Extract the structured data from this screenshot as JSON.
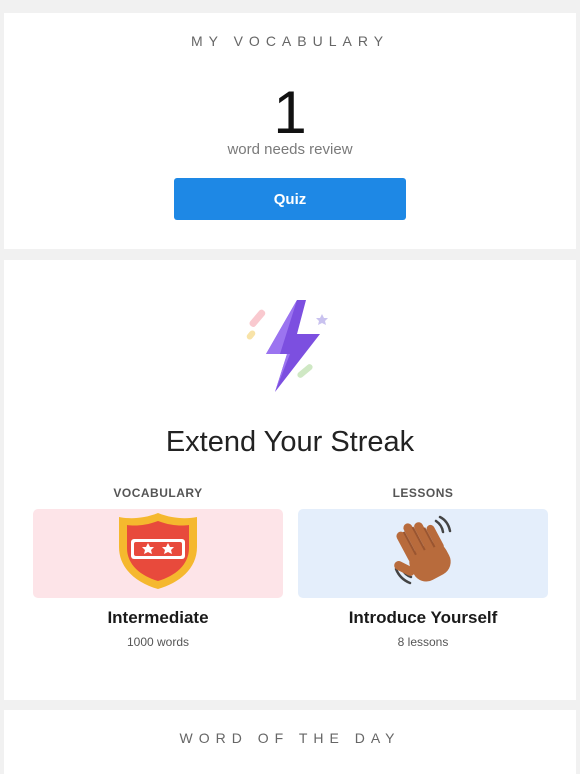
{
  "vocabulary": {
    "header": "MY VOCABULARY",
    "count": "1",
    "caption": "word needs review",
    "quiz_label": "Quiz"
  },
  "streak": {
    "title": "Extend Your Streak",
    "columns": [
      {
        "label": "VOCABULARY",
        "icon": "shield-stars-icon",
        "title": "Intermediate",
        "subtitle": "1000 words",
        "tile_color": "#fde4e8"
      },
      {
        "label": "LESSONS",
        "icon": "waving-hand-icon",
        "title": "Introduce Yourself",
        "subtitle": "8 lessons",
        "tile_color": "#e4eefb"
      }
    ]
  },
  "word_of_the_day": {
    "header": "WORD OF THE DAY"
  },
  "colors": {
    "accent": "#1e88e5",
    "background": "#f1f1f1",
    "bolt": "#8b5cf6"
  }
}
